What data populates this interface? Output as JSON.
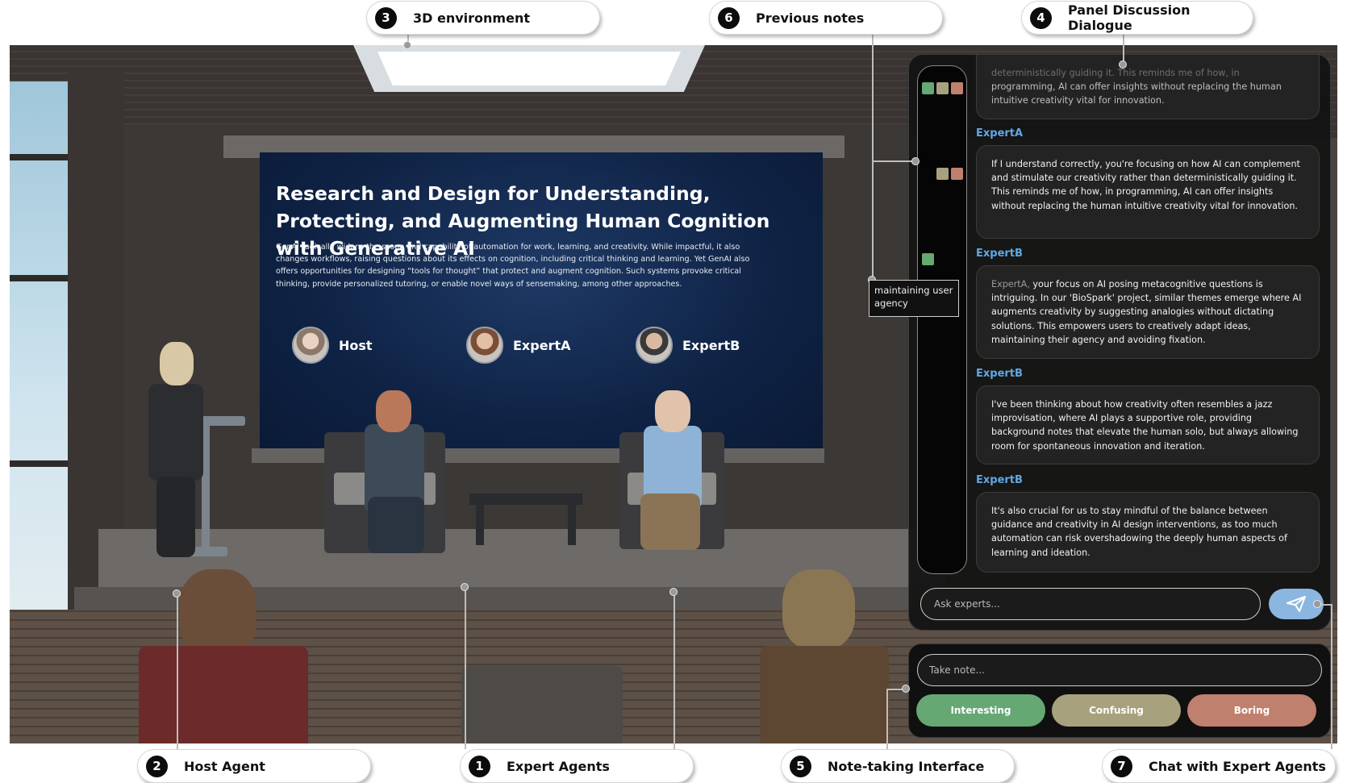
{
  "callouts": [
    {
      "num": "3",
      "label": "3D environment"
    },
    {
      "num": "6",
      "label": "Previous notes"
    },
    {
      "num": "4",
      "label": "Panel Discussion Dialogue"
    },
    {
      "num": "2",
      "label": "Host Agent"
    },
    {
      "num": "1",
      "label": "Expert Agents"
    },
    {
      "num": "5",
      "label": "Note-taking Interface"
    },
    {
      "num": "7",
      "label": "Chat with Expert Agents"
    }
  ],
  "screen": {
    "title": "Research and Design for Understanding, Protecting, and Augmenting Human Cognition with Generative AI",
    "abstract": "GenAI radically widens the scope and capability of automation for work, learning, and creativity. While impactful, it also changes workflows, raising questions about its effects on cognition, including critical thinking and learning. Yet GenAI also offers opportunities for designing “tools for thought” that protect and augment cognition. Such systems provoke critical thinking, provide personalized tutoring, or enable novel ways of sensemaking, among other approaches.",
    "agents": [
      {
        "label": "Host"
      },
      {
        "label": "ExpertA"
      },
      {
        "label": "ExpertB"
      }
    ]
  },
  "notes_tooltip": "maintaining user agency",
  "note_colors": {
    "interesting": "#65a873",
    "confusing": "#a8a17e",
    "boring": "#c0806e"
  },
  "dialogue": {
    "partial_text_dim": "deterministically guiding it. This reminds me of how, in",
    "partial_text": "programming, AI can offer insights without replacing the human intuitive creativity vital for innovation.",
    "messages": [
      {
        "speaker": "ExpertA",
        "text": "If I understand correctly, you're focusing on how AI can complement and stimulate our creativity rather than deterministically guiding it. This reminds me of how, in programming, AI can offer insights without replacing the human intuitive creativity vital for innovation."
      },
      {
        "speaker": "ExpertB",
        "mention": "ExpertA,",
        "text": " your focus on AI posing metacognitive questions is intriguing. In our 'BioSpark' project, similar themes emerge where AI augments creativity by suggesting analogies without dictating solutions. This empowers users to creatively adapt ideas, maintaining their agency and avoiding fixation."
      },
      {
        "speaker": "ExpertB",
        "text": "I've been thinking about how creativity often resembles a jazz improvisation, where AI plays a supportive role, providing background notes that elevate the human solo, but always allowing room for spontaneous innovation and iteration."
      },
      {
        "speaker": "ExpertB",
        "text": "It's also crucial for us to stay mindful of the balance between guidance and creativity in AI design interventions, as too much automation can risk overshadowing the deeply human aspects of learning and ideation."
      }
    ]
  },
  "chat": {
    "placeholder": "Ask experts..."
  },
  "note": {
    "placeholder": "Take note...",
    "buttons": [
      {
        "label": "Interesting",
        "color": "#65a873"
      },
      {
        "label": "Confusing",
        "color": "#a8a17e"
      },
      {
        "label": "Boring",
        "color": "#c0806e"
      }
    ]
  }
}
